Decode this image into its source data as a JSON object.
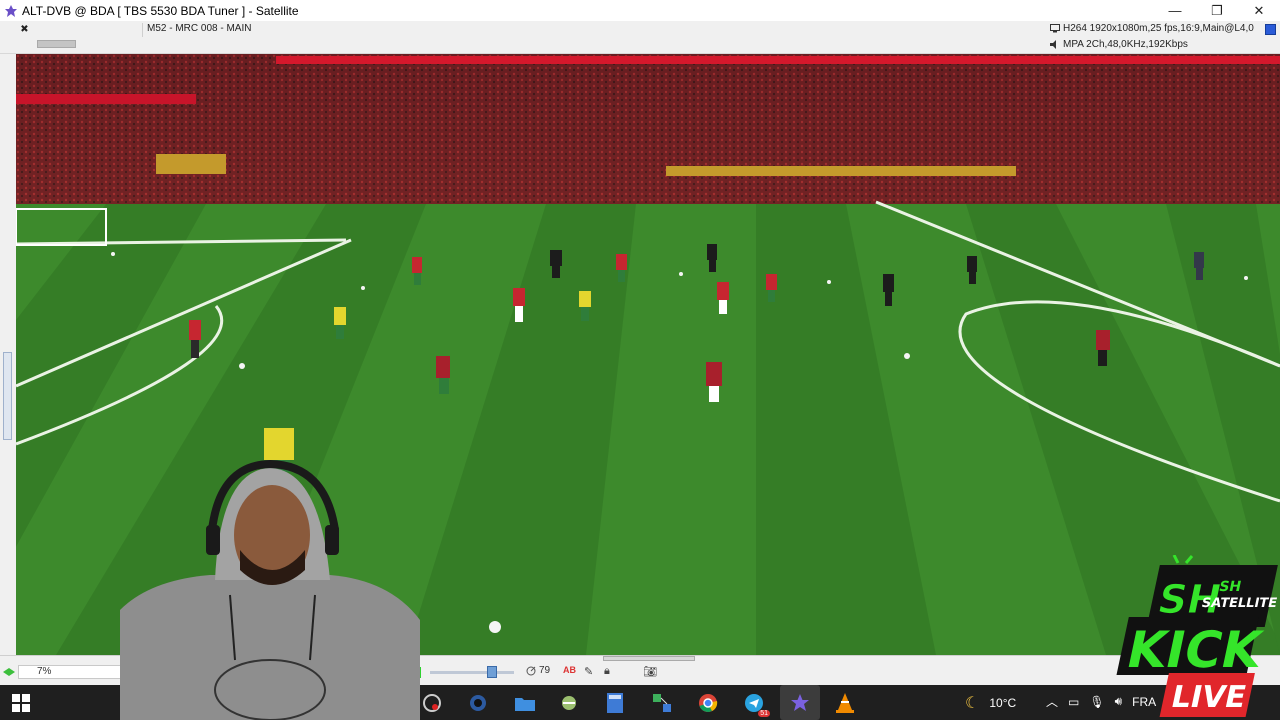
{
  "window": {
    "title": "ALT-DVB @ BDA [ TBS 5530 BDA Tuner ] - Satellite",
    "minimize": "—",
    "restore": "❐",
    "close": "✕"
  },
  "infobar": {
    "channel": "M52 - MRC 008 - MAIN",
    "video": "H264 1920x1080m,25 fps,16:9,Main@L4,0",
    "audio": "MPA 2Ch,48,0KHz,192Kbps"
  },
  "statusbar": {
    "zoom": "7%",
    "signal": "79",
    "ab_label": "AB"
  },
  "taskbar": {
    "weather": "10°C",
    "language": "FRA",
    "telegram_badge": "51"
  },
  "overlay": {
    "logo_lines": [
      "SH",
      "SATELLITE",
      "KICK",
      "LIVE"
    ]
  },
  "icons": {
    "app": "satellite-icon",
    "close_channel": "close-icon",
    "video": "monitor-icon",
    "audio": "speaker-icon"
  },
  "colors": {
    "pitch": "#3d8a2c",
    "logo_green": "#35e52a",
    "logo_red": "#e1262b",
    "taskbar": "#1f1f1f"
  }
}
